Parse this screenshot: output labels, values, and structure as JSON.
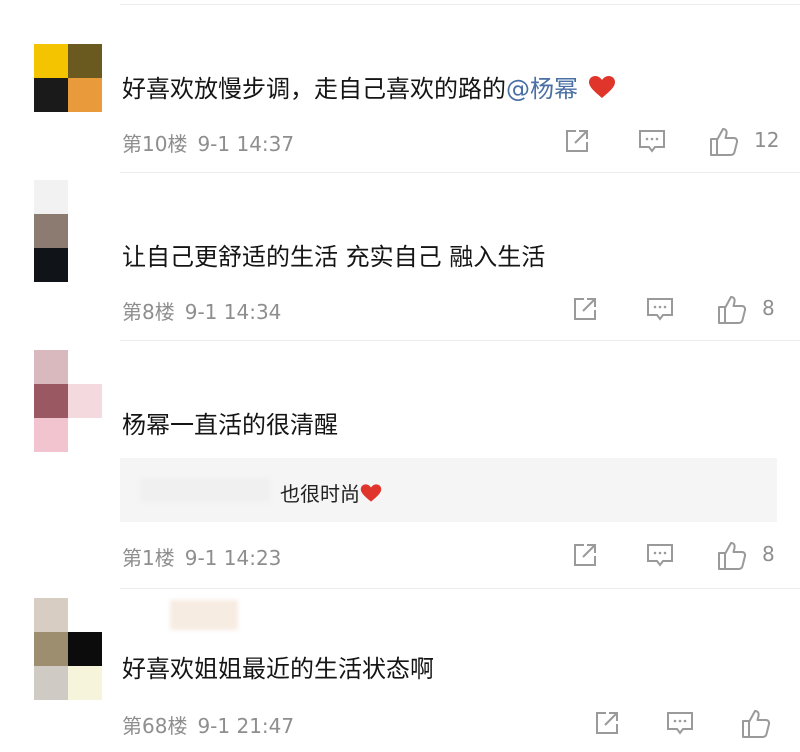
{
  "comments": [
    {
      "text": "好喜欢放慢步调，走自己喜欢的路的",
      "mention": "@杨幂",
      "has_heart": true,
      "floor": "第10楼",
      "time": "9-1 14:37",
      "likes": "12"
    },
    {
      "text": "让自己更舒适的生活 充实自己 融入生活",
      "floor": "第8楼",
      "time": "9-1 14:34",
      "likes": "8"
    },
    {
      "text": "杨幂一直活的很清醒",
      "reply": "也很时尚",
      "floor": "第1楼",
      "time": "9-1 14:23",
      "likes": "8"
    },
    {
      "text": "好喜欢姐姐最近的生活状态啊",
      "floor": "第68楼",
      "time": "9-1 21:47",
      "likes": ""
    }
  ],
  "icons": {
    "share": "share-icon",
    "comment": "comment-icon",
    "like": "thumb-up-icon",
    "heart": "heart-icon"
  },
  "colors": {
    "mention": "#4a6fa5",
    "heart": "#e0352b",
    "meta": "#8e8e8e",
    "icon": "#9a9a9a"
  }
}
